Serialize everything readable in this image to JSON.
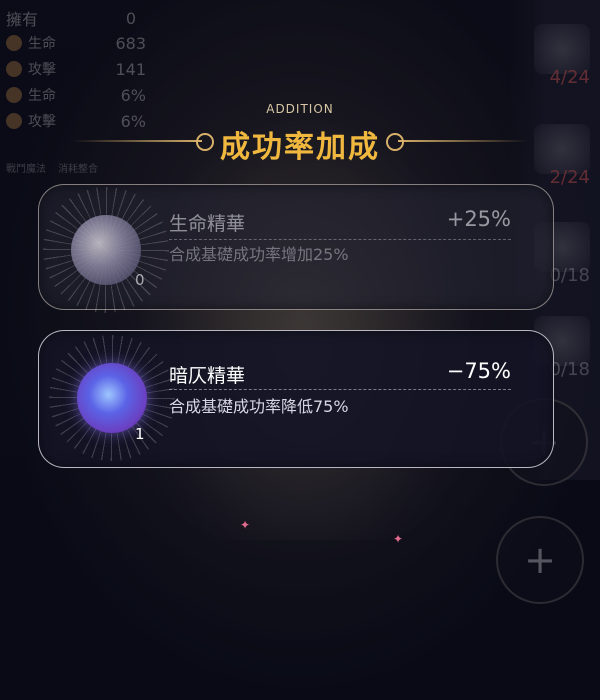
{
  "stats": {
    "own_label": "擁有",
    "own_value": "0",
    "rows": [
      {
        "name": "生命",
        "value": "683",
        "icon": "heart-icon"
      },
      {
        "name": "攻擊",
        "value": "141",
        "icon": "sword-icon"
      },
      {
        "name": "生命",
        "value": "6%",
        "icon": "heart-icon"
      },
      {
        "name": "攻擊",
        "value": "6%",
        "icon": "sword-icon"
      }
    ],
    "tabs": [
      "戰鬥魔法",
      "消耗整合"
    ]
  },
  "right_slots": [
    {
      "count": "4/24"
    },
    {
      "count": "2/24"
    },
    {
      "count": "0/18"
    },
    {
      "count": "0/18"
    }
  ],
  "header": {
    "subtitle": "ADDITION",
    "title": "成功率加成"
  },
  "items": [
    {
      "name": "生命精華",
      "percent": "+25%",
      "description": "合成基礎成功率增加25%",
      "count": "0",
      "icon": "life-essence-orb-icon"
    },
    {
      "name": "暗仄精華",
      "percent": "−75%",
      "description": "合成基礎成功率降低75%",
      "count": "1",
      "icon": "dark-essence-orb-icon"
    }
  ],
  "colors": {
    "title_gold": "#f0b83f",
    "ornament_gold": "#d7b06a",
    "slot_count_red": "#c85050"
  }
}
